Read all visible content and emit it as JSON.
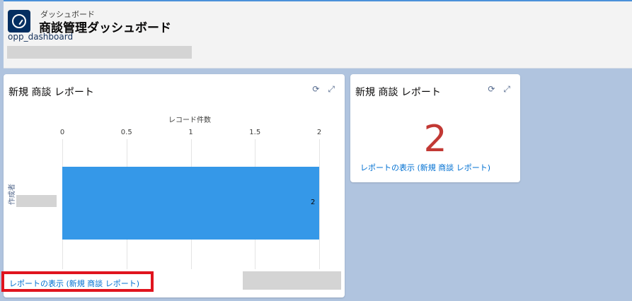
{
  "header": {
    "crumb": "ダッシュボード",
    "title": "商談管理ダッシュボード",
    "subname": "opp_dashboard"
  },
  "chart_card": {
    "title": "新規 商談 レポート",
    "link": "レポートの表示 (新規 商談 レポート)"
  },
  "number_card": {
    "title": "新規 商談 レポート",
    "value": "2",
    "link": "レポートの表示 (新規 商談 レポート)"
  },
  "icons": {
    "refresh": "refresh-icon",
    "expand": "expand-icon"
  },
  "chart_data": {
    "type": "bar",
    "orientation": "horizontal",
    "xlabel": "レコード件数",
    "ylabel": "作成者",
    "xticks": [
      "0",
      "0.5",
      "1",
      "1.5",
      "2"
    ],
    "xlim": [
      0,
      2
    ],
    "series": [
      {
        "values": [
          2
        ]
      }
    ],
    "data_labels": [
      "2"
    ],
    "bar_color": "#3598e8"
  },
  "colors": {
    "accent": "#0070d2",
    "metric": "#c23934",
    "highlight": "#e0141e"
  }
}
